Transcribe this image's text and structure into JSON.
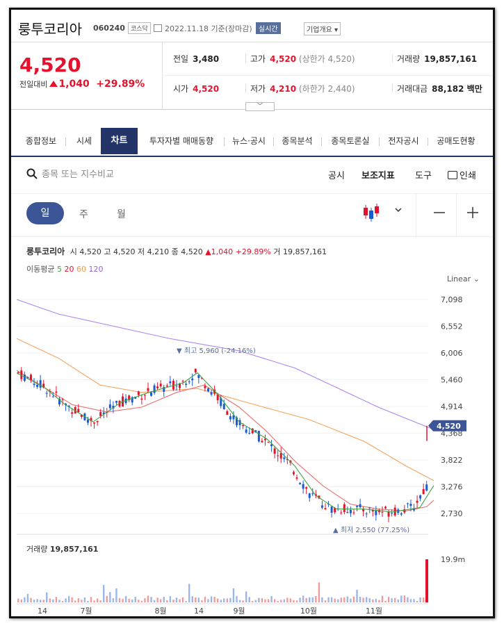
{
  "stock": {
    "name": "룽투코리아",
    "code": "060240",
    "market": "코스닥",
    "date": "2022.11.18 기준(장마감)",
    "live": "실시간",
    "corp_info": "기업개요",
    "price": "4,520",
    "change_label": "전일대비",
    "change": "1,040",
    "change_pct": "+29.89%"
  },
  "stats": {
    "prev_label": "전일",
    "prev": "3,480",
    "high_label": "고가",
    "high": "4,520",
    "upper_limit": "(상한가 4,520)",
    "volume_label": "거래량",
    "volume": "19,857,161",
    "open_label": "시가",
    "open": "4,520",
    "low_label": "저가",
    "low": "4,210",
    "lower_limit": "(하한가 2,440)",
    "amount_label": "거래대금",
    "amount": "88,182 백만"
  },
  "tabs": [
    "종합정보",
    "시세",
    "차트",
    "투자자별 매매동향",
    "뉴스·공시",
    "종목분석",
    "종목토론실",
    "전자공시",
    "공매도현황"
  ],
  "toolbar": {
    "search_placeholder": "종목 또는 지수비교",
    "items": [
      "공시",
      "보조지표",
      "도구",
      "인쇄"
    ]
  },
  "periods": [
    "일",
    "주",
    "월"
  ],
  "legend": {
    "name": "룽투코리아",
    "open_label": "시",
    "open": "4,520",
    "high_label": "고",
    "high": "4,520",
    "low_label": "저",
    "low": "4,210",
    "close_label": "종",
    "close": "4,520",
    "change": "1,040",
    "pct": "+29.89%",
    "vol_label": "거",
    "vol": "19,857,161"
  },
  "ma": {
    "label": "이동평균",
    "p5": "5",
    "p20": "20",
    "p60": "60",
    "p120": "120"
  },
  "scale": "Linear",
  "chart_data": {
    "type": "line",
    "y_ticks": [
      7098,
      6552,
      6006,
      5460,
      4914,
      4368,
      3822,
      3276,
      2730
    ],
    "x_ticks": [
      "14",
      "7월",
      "8월",
      "14",
      "9월",
      "10월",
      "11월"
    ],
    "current_price": "4,520",
    "max_annotation": "최고 5,960 (-24.16%)",
    "min_annotation": "최저 2,550 (77.25%)",
    "volume_label": "거래량",
    "volume": "19,857,161",
    "volume_max_tick": "19.9m",
    "series": [
      {
        "name": "5",
        "color": "#3fa33f"
      },
      {
        "name": "20",
        "color": "#e4132d"
      },
      {
        "name": "60",
        "color": "#f29a4a"
      },
      {
        "name": "120",
        "color": "#9b5fe0"
      }
    ]
  }
}
